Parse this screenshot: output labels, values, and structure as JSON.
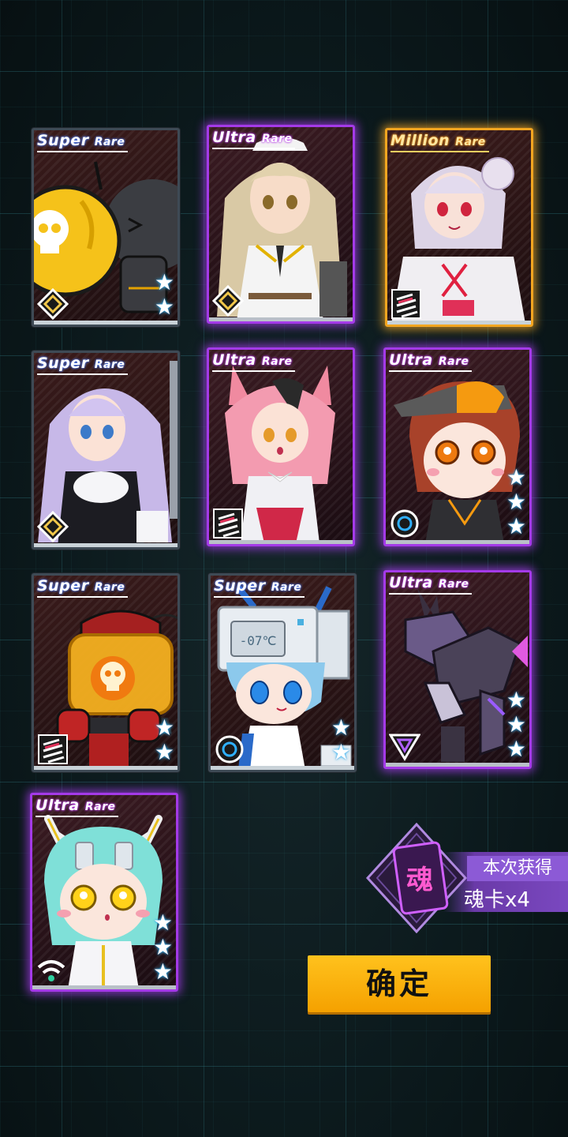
{
  "cards": [
    {
      "rarity_main": "Super",
      "rarity_sub": "Rare",
      "stars": 2
    },
    {
      "rarity_main": "Ultra",
      "rarity_sub": "Rare",
      "stars": 0
    },
    {
      "rarity_main": "Million",
      "rarity_sub": "Rare",
      "stars": 0
    },
    {
      "rarity_main": "Super",
      "rarity_sub": "Rare",
      "stars": 0
    },
    {
      "rarity_main": "Ultra",
      "rarity_sub": "Rare",
      "stars": 0
    },
    {
      "rarity_main": "Ultra",
      "rarity_sub": "Rare",
      "stars": 3
    },
    {
      "rarity_main": "Super",
      "rarity_sub": "Rare",
      "stars": 2
    },
    {
      "rarity_main": "Super",
      "rarity_sub": "Rare",
      "stars": 2
    },
    {
      "rarity_main": "Ultra",
      "rarity_sub": "Rare",
      "stars": 3
    },
    {
      "rarity_main": "Ultra",
      "rarity_sub": "Rare",
      "stars": 3
    }
  ],
  "card_art_text": {
    "freezer_display": "-07℃"
  },
  "reward": {
    "icon_char": "魂",
    "label": "本次获得",
    "count": "魂卡x4"
  },
  "confirm_label": "确定",
  "colors": {
    "super_rare_border": "#3e4a55",
    "ultra_rare_border": "#a43ae8",
    "million_rare_border": "#f2a520",
    "confirm_button": "#ffb400",
    "star": "#3dc5ff"
  }
}
